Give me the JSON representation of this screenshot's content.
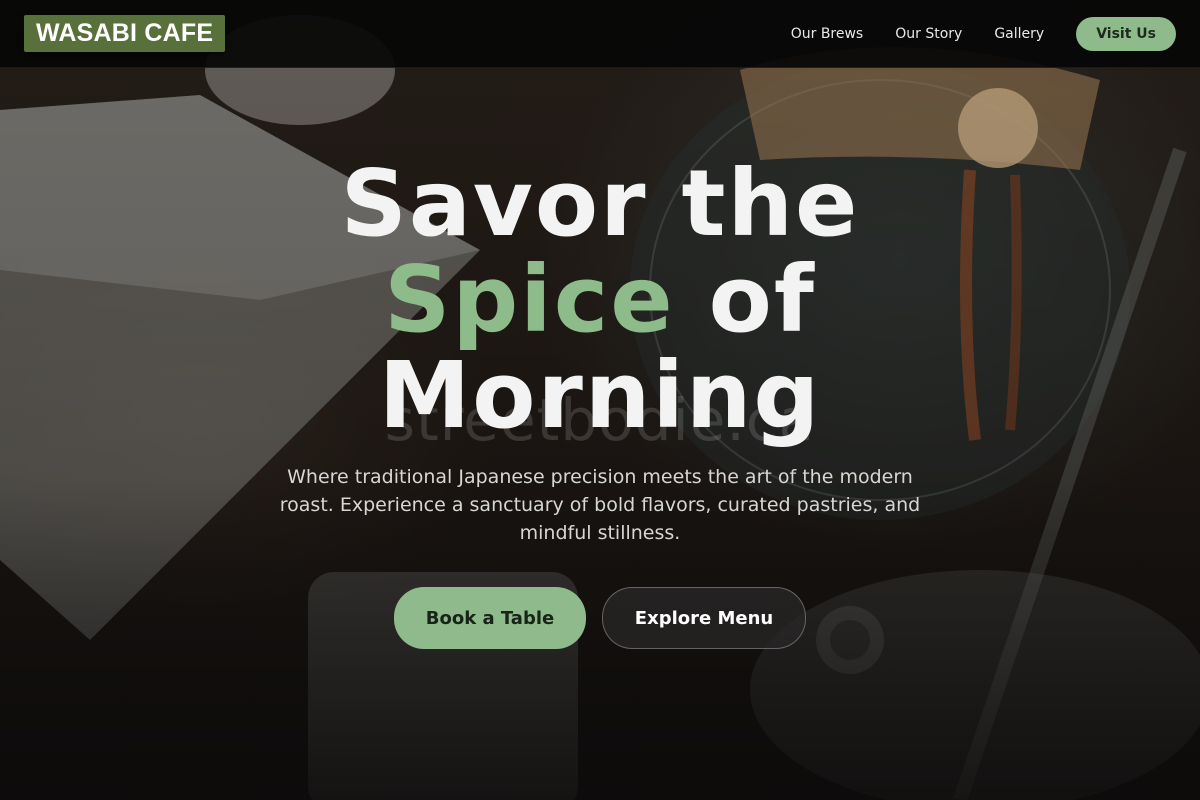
{
  "navbar": {
    "logo": "WASABI CAFE",
    "links": [
      {
        "label": "Our Brews"
      },
      {
        "label": "Our Story"
      },
      {
        "label": "Gallery"
      }
    ],
    "cta": "Visit Us"
  },
  "hero": {
    "headline": {
      "line1": "Savor the",
      "accent": "Spice",
      "line2_rest": " of",
      "line3": "Morning"
    },
    "watermark": "streetbodie.ca",
    "subtitle": "Where traditional Japanese precision meets the art of the modern roast. Experience a sanctuary of bold flavors, curated pastries, and mindful stillness.",
    "primary_button": "Book a Table",
    "secondary_button": "Explore Menu"
  },
  "colors": {
    "accent_green": "#8fbb8c",
    "logo_bg": "#58703a",
    "navbar_bg": "#060606"
  },
  "background": {
    "description_icon": "coffee-pour-over-photo"
  }
}
